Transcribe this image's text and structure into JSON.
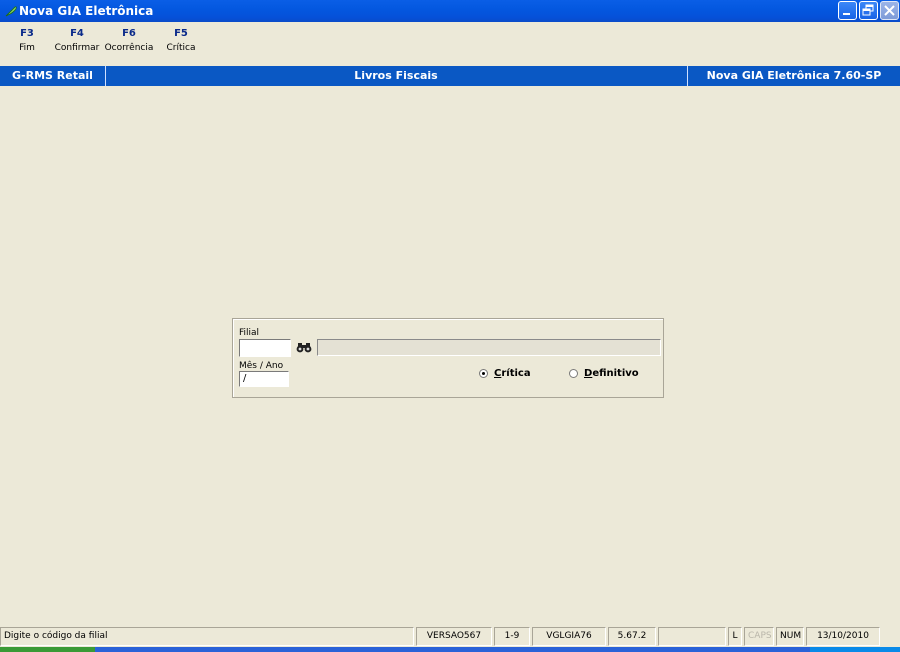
{
  "window": {
    "title": "Nova GIA Eletrônica"
  },
  "toolbar": {
    "keys": [
      {
        "key": "F3",
        "label": "Fim"
      },
      {
        "key": "F4",
        "label": "Confirmar"
      },
      {
        "key": "F6",
        "label": "Ocorrência"
      },
      {
        "key": "F5",
        "label": "Crítica"
      }
    ]
  },
  "header": {
    "left": "G-RMS Retail",
    "center": "Livros Fiscais",
    "right": "Nova GIA Eletrônica 7.60-SP"
  },
  "form": {
    "filial_label": "Filial",
    "filial_value": "",
    "descricao_value": "",
    "mesano_label": "Mês / Ano",
    "mesano_value": "/",
    "options": [
      {
        "label": "Crítica",
        "selected": true
      },
      {
        "label": "Definitivo",
        "selected": false
      }
    ]
  },
  "statusbar": {
    "message": "Digite o código da filial",
    "version": "VERSAO567",
    "range": "1-9",
    "program": "VGLGIA76",
    "build": "5.67.2",
    "blank": "",
    "l": "L",
    "caps": "CAPS",
    "num": "NUM",
    "date": "13/10/2010"
  },
  "icons": {
    "app": "feather-icon",
    "search": "binoculars-icon",
    "minimize": "minimize-icon",
    "restore": "restore-icon",
    "close": "close-icon"
  },
  "colors": {
    "titlebar": "#0458e0",
    "header_band": "#0a58c4",
    "background": "#ece9d8",
    "fkey_text": "#0a2a8a"
  }
}
